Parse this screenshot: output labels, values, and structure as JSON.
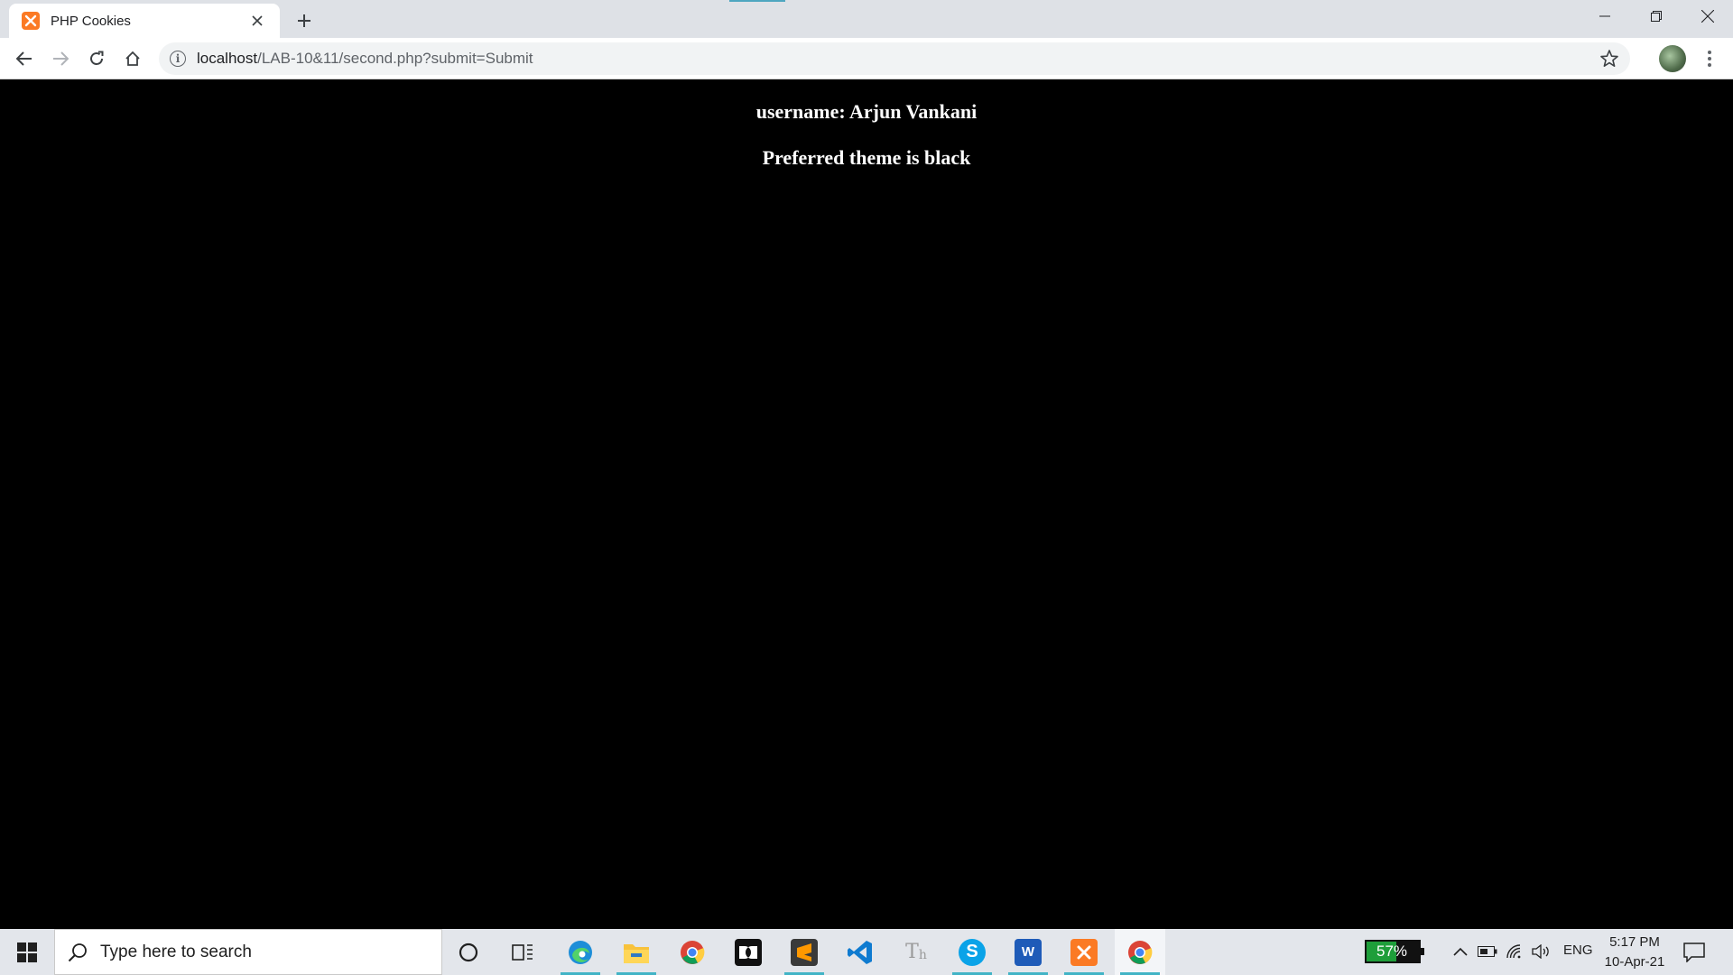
{
  "browser": {
    "tab_title": "PHP Cookies",
    "url_host": "localhost",
    "url_path": "/LAB-10&11/second.php?submit=Submit"
  },
  "page": {
    "username_line": "username: Arjun Vankani",
    "theme_line": "Preferred theme is black",
    "background_color": "#000000",
    "text_color": "#ffffff"
  },
  "taskbar": {
    "search_placeholder": "Type here to search",
    "apps": [
      "cortana-icon",
      "task-view-icon",
      "edge-icon",
      "file-explorer-icon",
      "chrome-icon",
      "dolby-icon",
      "sublime-text-icon",
      "vscode-icon",
      "typora-icon",
      "skype-icon",
      "word-icon",
      "xampp-icon",
      "chrome-icon"
    ],
    "battery_percent": "57%",
    "language": "ENG",
    "time": "5:17 PM",
    "date": "10-Apr-21"
  }
}
